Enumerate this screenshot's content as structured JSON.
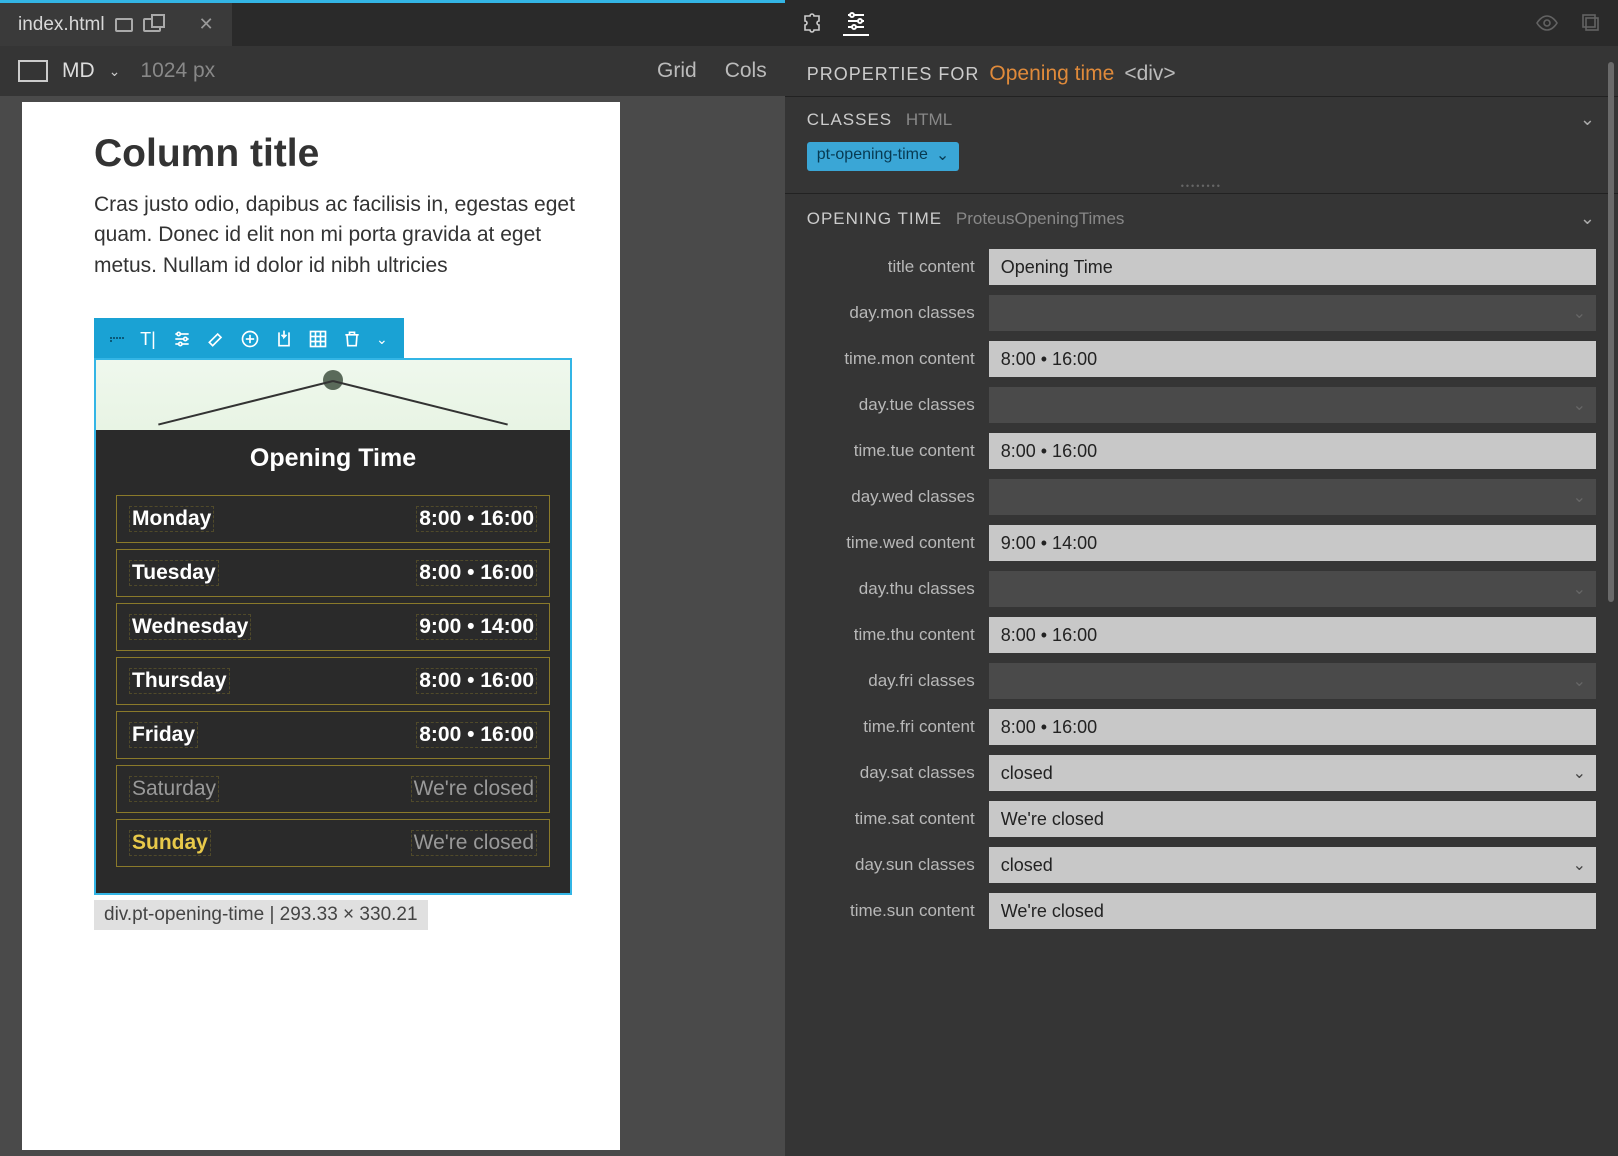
{
  "tab": {
    "filename": "index.html"
  },
  "breakpoint": {
    "label": "MD",
    "size": "1024 px",
    "grid": "Grid",
    "cols": "Cols"
  },
  "doc": {
    "heading": "Column title",
    "para": "Cras justo odio, dapibus ac facilisis in, egestas eget quam. Donec id elit non mi porta gravida at eget metus. Nullam id dolor id nibh ultricies"
  },
  "widget": {
    "title": "Opening Time",
    "rows": [
      {
        "day": "Monday",
        "time": "8:00 • 16:00",
        "cls": ""
      },
      {
        "day": "Tuesday",
        "time": "8:00 • 16:00",
        "cls": ""
      },
      {
        "day": "Wednesday",
        "time": "9:00 • 14:00",
        "cls": ""
      },
      {
        "day": "Thursday",
        "time": "8:00 • 16:00",
        "cls": ""
      },
      {
        "day": "Friday",
        "time": "8:00 • 16:00",
        "cls": ""
      },
      {
        "day": "Saturday",
        "time": "We're closed",
        "cls": "closed"
      },
      {
        "day": "Sunday",
        "time": "We're closed",
        "cls": "today"
      }
    ]
  },
  "selectionInfo": "div.pt-opening-time  |  293.33 × 330.21",
  "propsHeader": {
    "label": "PROPERTIES FOR",
    "name": "Opening time",
    "tag": "<div>"
  },
  "classesSection": {
    "title": "CLASSES",
    "sub": "HTML",
    "chip": "pt-opening-time"
  },
  "componentSection": {
    "title": "OPENING TIME",
    "sub": "ProteusOpeningTimes"
  },
  "props": [
    {
      "label": "title content",
      "type": "text",
      "value": "Opening Time"
    },
    {
      "label": "day.mon classes",
      "type": "select",
      "value": ""
    },
    {
      "label": "time.mon content",
      "type": "text",
      "value": "8:00 • 16:00"
    },
    {
      "label": "day.tue classes",
      "type": "select",
      "value": ""
    },
    {
      "label": "time.tue content",
      "type": "text",
      "value": "8:00 • 16:00"
    },
    {
      "label": "day.wed classes",
      "type": "select",
      "value": ""
    },
    {
      "label": "time.wed content",
      "type": "text",
      "value": "9:00 • 14:00"
    },
    {
      "label": "day.thu classes",
      "type": "select",
      "value": ""
    },
    {
      "label": "time.thu content",
      "type": "text",
      "value": "8:00 • 16:00"
    },
    {
      "label": "day.fri classes",
      "type": "select",
      "value": ""
    },
    {
      "label": "time.fri content",
      "type": "text",
      "value": "8:00 • 16:00"
    },
    {
      "label": "day.sat classes",
      "type": "selectL",
      "value": "closed"
    },
    {
      "label": "time.sat content",
      "type": "text",
      "value": "We're closed"
    },
    {
      "label": "day.sun classes",
      "type": "selectL",
      "value": "closed"
    },
    {
      "label": "time.sun content",
      "type": "text",
      "value": "We're closed"
    }
  ]
}
